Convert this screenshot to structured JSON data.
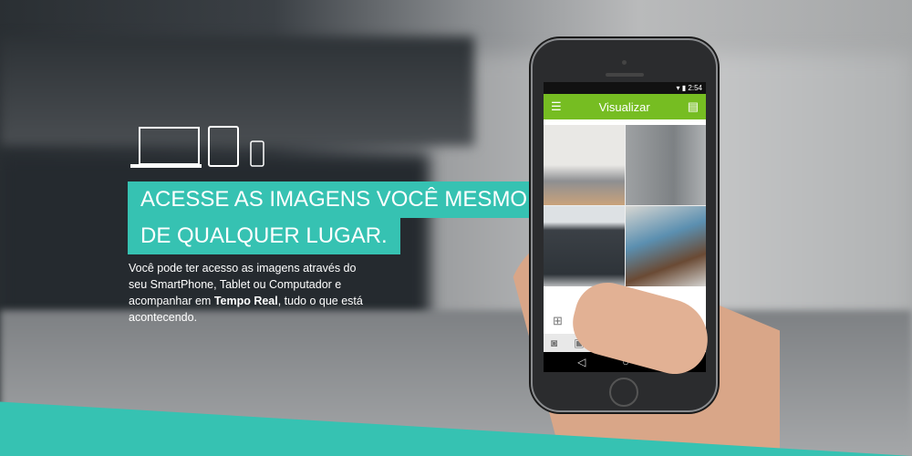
{
  "headline": {
    "line1": "ACESSE AS IMAGENS VOCÊ MESMO,",
    "line2": "DE QUALQUER LUGAR."
  },
  "copy": {
    "part1": "Você pode ter acesso as imagens através do seu SmartPhone, Tablet ou Computador e acompanhar em ",
    "bold": "Tempo Real",
    "part2": ", tudo o que está acontecendo."
  },
  "phone": {
    "time": "2:54",
    "app_title": "Visualizar"
  },
  "colors": {
    "accent": "#36c2b2",
    "app_bar": "#76bd22"
  }
}
